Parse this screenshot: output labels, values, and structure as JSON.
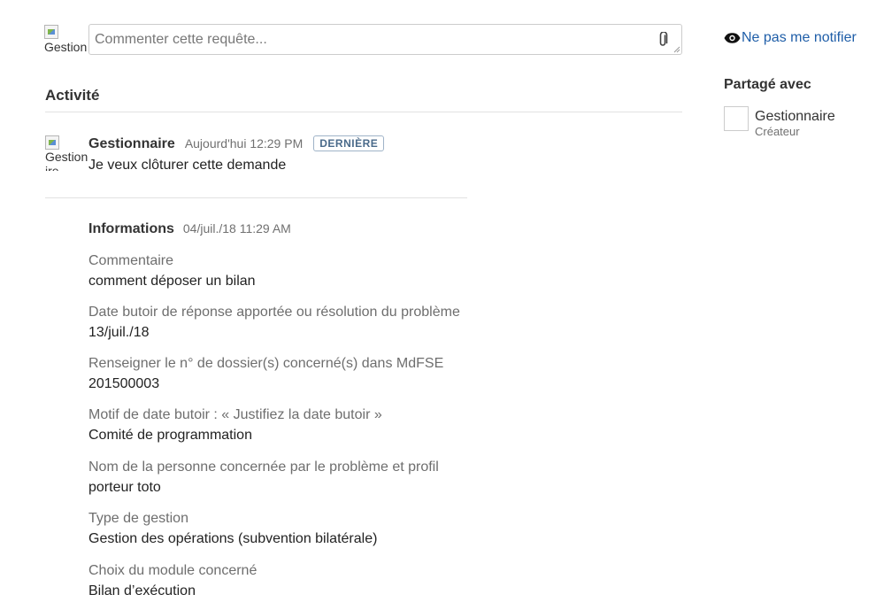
{
  "composer": {
    "avatar_alt": "Gestionnaire",
    "placeholder": "Commenter cette requête...",
    "attach_icon": "paperclip-icon"
  },
  "notify": {
    "icon": "eye-icon",
    "label": "Ne pas me notifier",
    "color": "#1f5ea8"
  },
  "shared": {
    "title": "Partagé avec",
    "users": [
      {
        "name": "Gestionnaire",
        "role": "Créateur"
      }
    ]
  },
  "activity": {
    "title": "Activité",
    "entries": [
      {
        "avatar_alt_line1": "Gestionna",
        "avatar_alt_line2": "ire",
        "author": "Gestionnaire",
        "time": "Aujourd'hui 12:29 PM",
        "badge": "DERNIÈRE",
        "text": "Je veux clôturer cette demande"
      }
    ],
    "info": {
      "title": "Informations",
      "time": "04/juil./18 11:29 AM",
      "fields": [
        {
          "label": "Commentaire",
          "value": "comment déposer un bilan"
        },
        {
          "label": "Date butoir de réponse apportée ou résolution du problème",
          "value": "13/juil./18"
        },
        {
          "label": "Renseigner le n° de dossier(s) concerné(s) dans MdFSE",
          "value": "201500003"
        },
        {
          "label": "Motif de date butoir : « Justifiez la date butoir »",
          "value": "Comité de programmation"
        },
        {
          "label": "Nom de la personne concernée par le problème et profil",
          "value": "porteur toto"
        },
        {
          "label": "Type de gestion",
          "value": "Gestion des opérations (subvention bilatérale)"
        },
        {
          "label": "Choix du module concerné",
          "value": "Bilan d’exécution"
        }
      ]
    }
  }
}
